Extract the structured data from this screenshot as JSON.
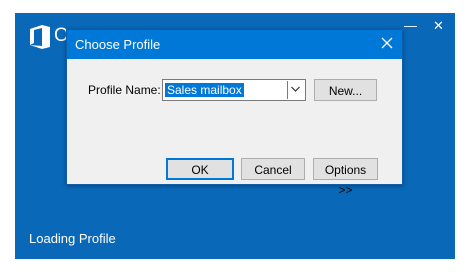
{
  "splash": {
    "app_name_partial": "O",
    "status_text": "Loading Profile",
    "background_color": "#0a68b8",
    "logo_icon": "office-logo-icon",
    "minimize_icon": "minimize-icon",
    "close_icon": "close-icon"
  },
  "dialog": {
    "title": "Choose Profile",
    "close_icon": "close-icon",
    "titlebar_color": "#0078d7",
    "profile_label": "Profile Name:",
    "profile_value": "Sales mailbox",
    "dropdown_icon": "chevron-down-icon",
    "buttons": {
      "new": "New...",
      "ok": "OK",
      "cancel": "Cancel",
      "options": "Options >>"
    }
  }
}
